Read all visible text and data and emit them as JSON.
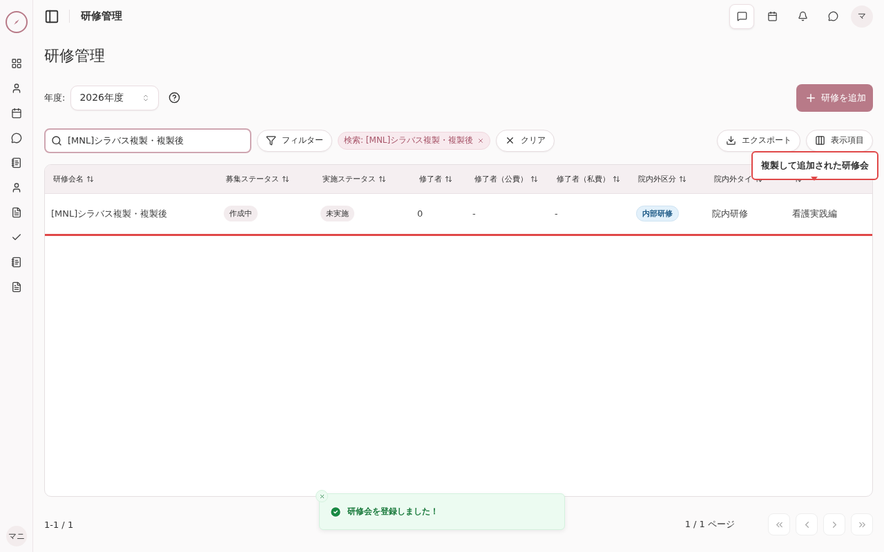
{
  "header": {
    "title": "研修管理",
    "avatar": "マ"
  },
  "sidebar": {
    "user_avatar": "マニ"
  },
  "page_title": "研修管理",
  "year": {
    "label": "年度:",
    "value": "2026年度"
  },
  "add_button": "研修を追加",
  "search": {
    "value": "[MNL]シラバス複製・複製後"
  },
  "filter_button": "フィルター",
  "search_chip": "検索: [MNL]シラバス複製・複製後",
  "clear_button": "クリア",
  "export_button": "エクスポート",
  "columns_button": "表示項目",
  "table": {
    "columns": [
      {
        "label": "研修会名"
      },
      {
        "label": "募集ステータス"
      },
      {
        "label": "実施ステータス"
      },
      {
        "label": "修了者"
      },
      {
        "label": "修了者（公費）"
      },
      {
        "label": "修了者（私費）"
      },
      {
        "label": "院内外区分"
      },
      {
        "label": "院内外タイ"
      },
      {}
    ],
    "rows": [
      {
        "highlighted": true,
        "cells": [
          {
            "kind": "text",
            "text": "[MNL]シラバス複製・複製後"
          },
          {
            "kind": "pill",
            "text": "作成中"
          },
          {
            "kind": "pill",
            "text": "未実施"
          },
          {
            "kind": "text",
            "text": "0"
          },
          {
            "kind": "text",
            "text": "-"
          },
          {
            "kind": "text",
            "text": "-"
          },
          {
            "kind": "tag",
            "text": "内部研修"
          },
          {
            "kind": "text",
            "text": "院内研修"
          },
          {
            "kind": "text",
            "text": "看護実践編"
          }
        ]
      }
    ]
  },
  "tooltip": "複製して追加された研修会",
  "toast": "研修会を登録しました！",
  "pagination": {
    "range": "1-1 / 1",
    "page": "1 / 1 ページ"
  }
}
